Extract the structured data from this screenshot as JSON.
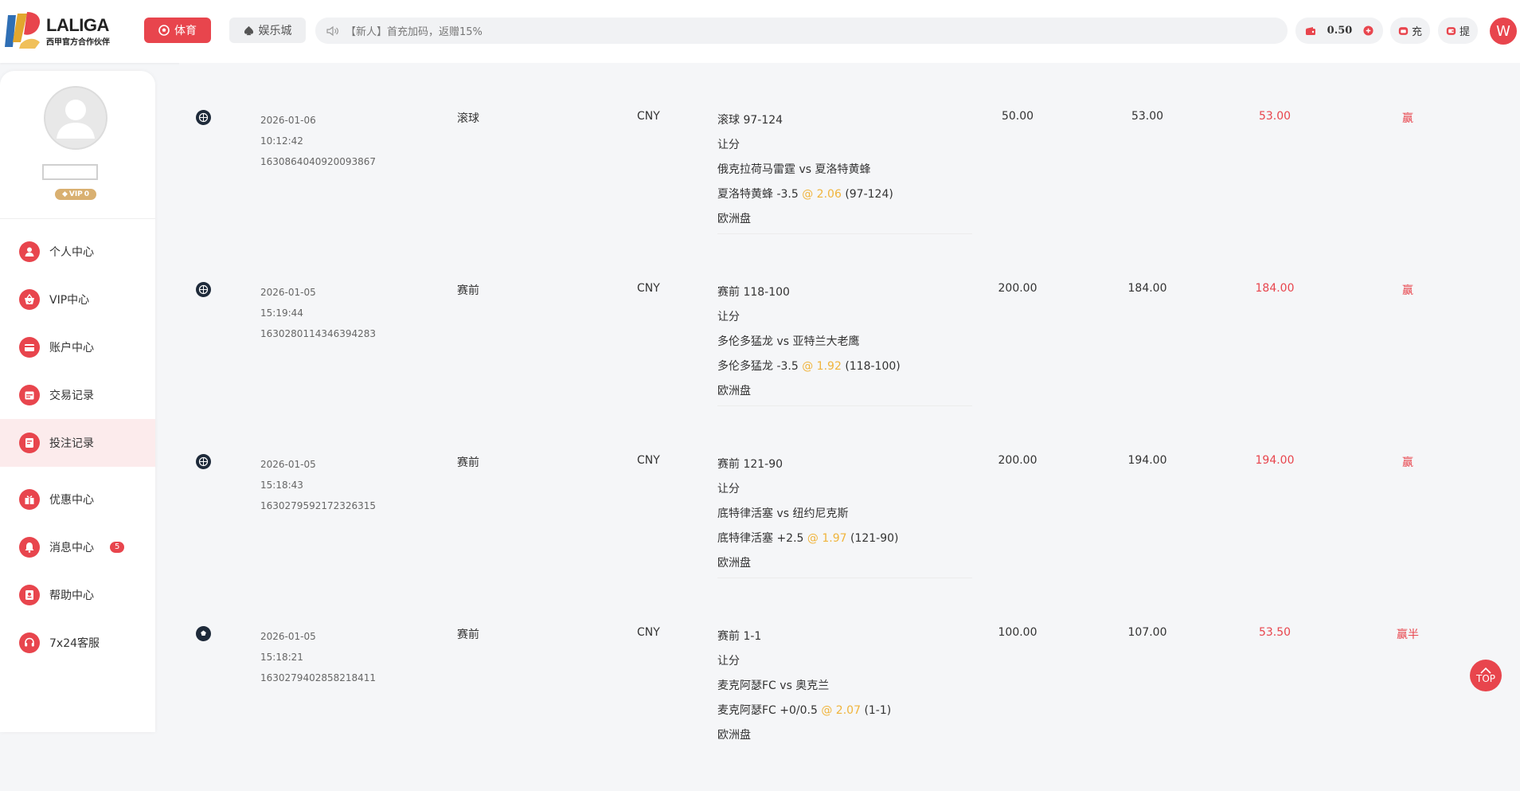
{
  "header": {
    "logo_name": "LALIGA",
    "logo_sub": "西甲官方合作伙伴",
    "nav_sports": "体育",
    "nav_casino": "娱乐城",
    "marquee": "【新人】首充加码，返赠15%",
    "balance": "0.50",
    "deposit_label": "充",
    "withdraw_label": "提",
    "avatar_initial": "W"
  },
  "profile": {
    "vip_label": "VIP",
    "vip_level": "0"
  },
  "sidebar": {
    "items": [
      {
        "label": "个人中心"
      },
      {
        "label": "VIP中心"
      },
      {
        "label": "账户中心"
      },
      {
        "label": "交易记录"
      },
      {
        "label": "投注记录"
      },
      {
        "label": "优惠中心"
      },
      {
        "label": "消息中心",
        "badge": "5"
      },
      {
        "label": "帮助中心"
      },
      {
        "label": "7x24客服"
      }
    ]
  },
  "bets": [
    {
      "date": "2026-01-06",
      "time": "10:12:42",
      "order_id": "1630864040920093867",
      "type": "滚球",
      "currency": "CNY",
      "score_line": "滚球  97-124",
      "market": "让分",
      "match": "俄克拉荷马雷霆 vs 夏洛特黄蜂",
      "selection": "夏洛特黄蜂 -3.5",
      "odds": "@ 2.06",
      "score": "(97-124)",
      "odds_type": "欧洲盘",
      "stake": "50.00",
      "payout": "53.00",
      "profit": "53.00",
      "result": "赢"
    },
    {
      "date": "2026-01-05",
      "time": "15:19:44",
      "order_id": "1630280114346394283",
      "type": "赛前",
      "currency": "CNY",
      "score_line": "赛前  118-100",
      "market": "让分",
      "match": "多伦多猛龙 vs 亚特兰大老鹰",
      "selection": "多伦多猛龙 -3.5",
      "odds": "@ 1.92",
      "score": "(118-100)",
      "odds_type": "欧洲盘",
      "stake": "200.00",
      "payout": "184.00",
      "profit": "184.00",
      "result": "赢"
    },
    {
      "date": "2026-01-05",
      "time": "15:18:43",
      "order_id": "1630279592172326315",
      "type": "赛前",
      "currency": "CNY",
      "score_line": "赛前  121-90",
      "market": "让分",
      "match": "底特律活塞 vs 纽约尼克斯",
      "selection": "底特律活塞 +2.5",
      "odds": "@ 1.97",
      "score": "(121-90)",
      "odds_type": "欧洲盘",
      "stake": "200.00",
      "payout": "194.00",
      "profit": "194.00",
      "result": "赢"
    },
    {
      "date": "2026-01-05",
      "time": "15:18:21",
      "order_id": "1630279402858218411",
      "type": "赛前",
      "currency": "CNY",
      "score_line": "赛前  1-1",
      "market": "让分",
      "match": "麦克阿瑟FC vs 奥克兰",
      "selection": "麦克阿瑟FC +0/0.5",
      "odds": "@ 2.07",
      "score": "(1-1)",
      "odds_type": "欧洲盘",
      "stake": "100.00",
      "payout": "107.00",
      "profit": "53.50",
      "result": "赢半"
    }
  ],
  "top_button": "TOP",
  "colors": {
    "accent": "#e8454d",
    "odds": "#f0b43c",
    "vip": "#d9b071"
  }
}
